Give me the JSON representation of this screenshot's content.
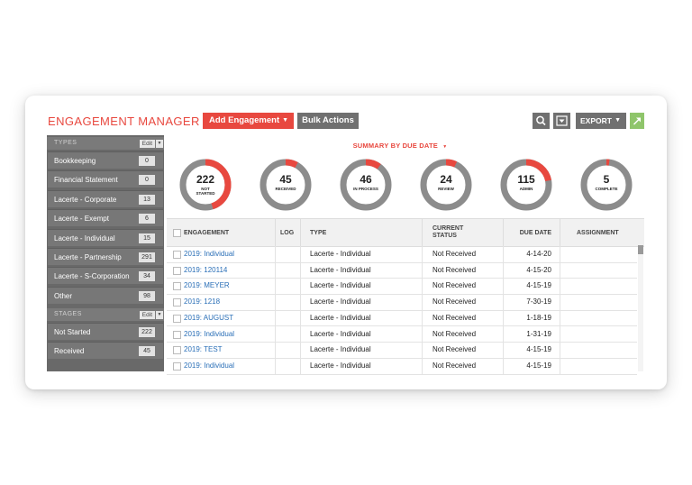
{
  "header": {
    "title": "ENGAGEMENT MANAGER",
    "add_label": "Add Engagement",
    "add_caret": "▼",
    "bulk_label": "Bulk Actions",
    "export_label": "EXPORT",
    "export_caret": "▼"
  },
  "sidebar": {
    "types_label": "TYPES",
    "stages_label": "STAGES",
    "edit_label": "Edit",
    "types": [
      {
        "label": "Bookkeeping",
        "count": "0"
      },
      {
        "label": "Financial Statement",
        "count": "0"
      },
      {
        "label": "Lacerte - Corporate",
        "count": "13"
      },
      {
        "label": "Lacerte - Exempt",
        "count": "6"
      },
      {
        "label": "Lacerte - Individual",
        "count": "15"
      },
      {
        "label": "Lacerte - Partnership",
        "count": "291"
      },
      {
        "label": "Lacerte - S-Corporation",
        "count": "34"
      },
      {
        "label": "Other",
        "count": "98"
      }
    ],
    "stages": [
      {
        "label": "Not Started",
        "count": "222"
      },
      {
        "label": "Received",
        "count": "45"
      }
    ]
  },
  "summary": {
    "label": "SUMMARY BY DUE DATE",
    "caret": "▼",
    "items": [
      {
        "count": "222",
        "label1": "NOT",
        "label2": "STARTED",
        "fraction": 0.45
      },
      {
        "count": "45",
        "label1": "RECEIVED",
        "label2": "",
        "fraction": 0.08
      },
      {
        "count": "46",
        "label1": "IN PROCESS",
        "label2": "",
        "fraction": 0.1
      },
      {
        "count": "24",
        "label1": "REVIEW",
        "label2": "",
        "fraction": 0.07
      },
      {
        "count": "115",
        "label1": "ADMIN",
        "label2": "",
        "fraction": 0.22
      },
      {
        "count": "5",
        "label1": "COMPLETE",
        "label2": "",
        "fraction": 0.02
      }
    ]
  },
  "table": {
    "headers": {
      "engagement": "ENGAGEMENT",
      "log": "LOG",
      "type": "TYPE",
      "status1": "CURRENT",
      "status2": "STATUS",
      "due": "DUE DATE",
      "assignment": "ASSIGNMENT"
    },
    "rows": [
      {
        "engagement": "2019: Individual",
        "type": "Lacerte - Individual",
        "status": "Not Received",
        "due": "4-14-20"
      },
      {
        "engagement": "2019: 120114",
        "type": "Lacerte - Individual",
        "status": "Not Received",
        "due": "4-15-20"
      },
      {
        "engagement": "2019: MEYER",
        "type": "Lacerte - Individual",
        "status": "Not Received",
        "due": "4-15-19"
      },
      {
        "engagement": "2019: 1218",
        "type": "Lacerte - Individual",
        "status": "Not Received",
        "due": "7-30-19"
      },
      {
        "engagement": "2019: AUGUST",
        "type": "Lacerte - Individual",
        "status": "Not Received",
        "due": "1-18-19"
      },
      {
        "engagement": "2019: Individual",
        "type": "Lacerte - Individual",
        "status": "Not Received",
        "due": "1-31-19"
      },
      {
        "engagement": "2019: TEST",
        "type": "Lacerte - Individual",
        "status": "Not Received",
        "due": "4-15-19"
      },
      {
        "engagement": "2019: Individual",
        "type": "Lacerte - Individual",
        "status": "Not Received",
        "due": "4-15-19"
      }
    ]
  },
  "colors": {
    "accent": "#e8483f",
    "ring_track": "#8c8c8c",
    "link": "#2a6fb7",
    "open_button": "#8fc56b"
  },
  "icons": [
    "search-icon",
    "filter-icon",
    "caret-down-icon",
    "open-external-icon",
    "checkbox-icon"
  ]
}
